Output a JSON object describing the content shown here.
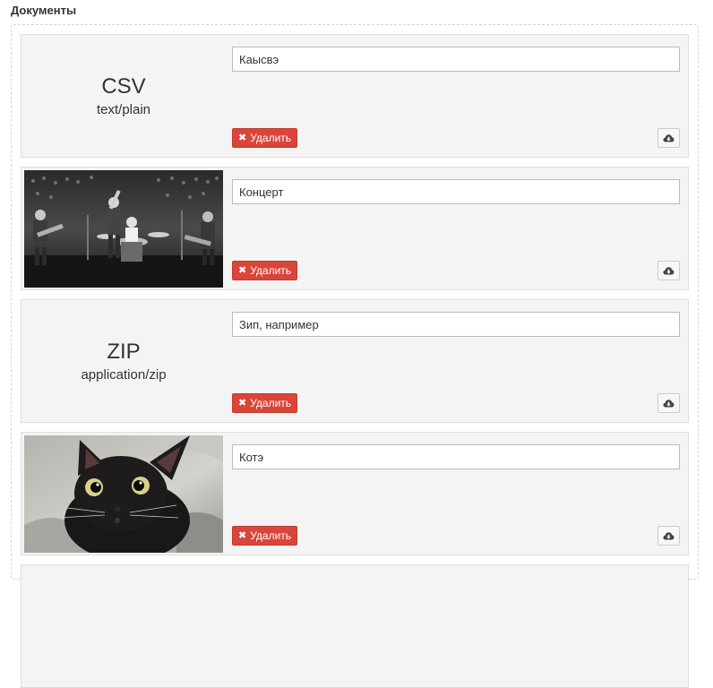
{
  "section": {
    "title": "Документы"
  },
  "documents": [
    {
      "preview": "type",
      "ext": "CSV",
      "mime": "text/plain",
      "title_value": "Каысвэ",
      "delete_label": "Удалить",
      "download_icon": "cloud-download-icon"
    },
    {
      "preview": "image",
      "image_subject": "concert-photo",
      "title_value": "Концерт",
      "delete_label": "Удалить",
      "download_icon": "cloud-download-icon"
    },
    {
      "preview": "type",
      "ext": "ZIP",
      "mime": "application/zip",
      "title_value": "Зип, например",
      "delete_label": "Удалить",
      "download_icon": "cloud-download-icon"
    },
    {
      "preview": "image",
      "image_subject": "black-cat-photo",
      "title_value": "Котэ",
      "delete_label": "Удалить",
      "download_icon": "cloud-download-icon"
    }
  ],
  "colors": {
    "delete_button": "#d9453a",
    "card_background": "#f4f4f4"
  }
}
